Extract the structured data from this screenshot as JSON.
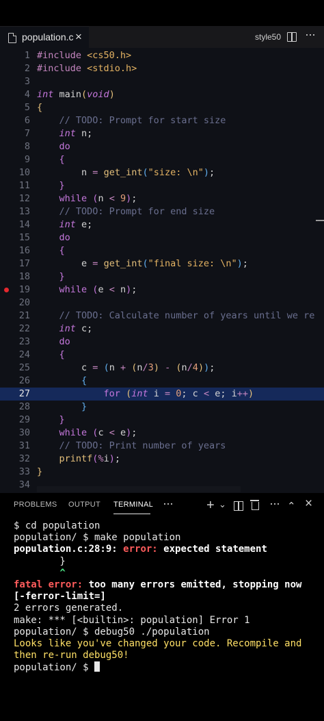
{
  "tab": {
    "filename": "population.c",
    "close": "×"
  },
  "toolbar": {
    "style50": "style50"
  },
  "editor": {
    "lines": [
      {
        "n": "1",
        "segs": [
          [
            "c-pp",
            "#include "
          ],
          [
            "c-str",
            "<cs50.h>"
          ]
        ]
      },
      {
        "n": "2",
        "segs": [
          [
            "c-pp",
            "#include "
          ],
          [
            "c-str",
            "<stdio.h>"
          ]
        ]
      },
      {
        "n": "3",
        "segs": []
      },
      {
        "n": "4",
        "segs": [
          [
            "c-type",
            "int"
          ],
          [
            "c-plain",
            " main"
          ],
          [
            "c-br",
            "("
          ],
          [
            "c-type",
            "void"
          ],
          [
            "c-br",
            ")"
          ]
        ]
      },
      {
        "n": "5",
        "segs": [
          [
            "c-br",
            "{"
          ]
        ]
      },
      {
        "n": "6",
        "segs": [
          [
            "c-cm",
            "    // TODO: Prompt for start size"
          ]
        ]
      },
      {
        "n": "7",
        "segs": [
          [
            "c-plain",
            "    "
          ],
          [
            "c-type",
            "int"
          ],
          [
            "c-plain",
            " n;"
          ]
        ]
      },
      {
        "n": "8",
        "segs": [
          [
            "c-plain",
            "    "
          ],
          [
            "c-kw",
            "do"
          ]
        ]
      },
      {
        "n": "9",
        "segs": [
          [
            "c-plain",
            "    "
          ],
          [
            "c-br2",
            "{"
          ]
        ]
      },
      {
        "n": "10",
        "segs": [
          [
            "c-plain",
            "        n "
          ],
          [
            "c-op",
            "="
          ],
          [
            "c-plain",
            " "
          ],
          [
            "c-fn",
            "get_int"
          ],
          [
            "c-br3",
            "("
          ],
          [
            "c-str",
            "\"size: \\n\""
          ],
          [
            "c-br3",
            ")"
          ],
          [
            "c-plain",
            ";"
          ]
        ]
      },
      {
        "n": "11",
        "segs": [
          [
            "c-plain",
            "    "
          ],
          [
            "c-br2",
            "}"
          ]
        ]
      },
      {
        "n": "12",
        "segs": [
          [
            "c-plain",
            "    "
          ],
          [
            "c-kw",
            "while"
          ],
          [
            "c-plain",
            " "
          ],
          [
            "c-br2",
            "("
          ],
          [
            "c-plain",
            "n "
          ],
          [
            "c-op",
            "<"
          ],
          [
            "c-plain",
            " "
          ],
          [
            "c-num",
            "9"
          ],
          [
            "c-br2",
            ")"
          ],
          [
            "c-plain",
            ";"
          ]
        ]
      },
      {
        "n": "13",
        "segs": [
          [
            "c-cm",
            "    // TODO: Prompt for end size"
          ]
        ]
      },
      {
        "n": "14",
        "segs": [
          [
            "c-plain",
            "    "
          ],
          [
            "c-type",
            "int"
          ],
          [
            "c-plain",
            " e;"
          ]
        ]
      },
      {
        "n": "15",
        "segs": [
          [
            "c-plain",
            "    "
          ],
          [
            "c-kw",
            "do"
          ]
        ]
      },
      {
        "n": "16",
        "segs": [
          [
            "c-plain",
            "    "
          ],
          [
            "c-br2",
            "{"
          ]
        ]
      },
      {
        "n": "17",
        "segs": [
          [
            "c-plain",
            "        e "
          ],
          [
            "c-op",
            "="
          ],
          [
            "c-plain",
            " "
          ],
          [
            "c-fn",
            "get_int"
          ],
          [
            "c-br3",
            "("
          ],
          [
            "c-str",
            "\"final size: \\n\""
          ],
          [
            "c-br3",
            ")"
          ],
          [
            "c-plain",
            ";"
          ]
        ]
      },
      {
        "n": "18",
        "segs": [
          [
            "c-plain",
            "    "
          ],
          [
            "c-br2",
            "}"
          ]
        ]
      },
      {
        "n": "19",
        "segs": [
          [
            "c-plain",
            "    "
          ],
          [
            "c-kw",
            "while"
          ],
          [
            "c-plain",
            " "
          ],
          [
            "c-br2",
            "("
          ],
          [
            "c-plain",
            "e "
          ],
          [
            "c-op",
            "<"
          ],
          [
            "c-plain",
            " n"
          ],
          [
            "c-br2",
            ")"
          ],
          [
            "c-plain",
            ";"
          ]
        ],
        "breakpoint": true
      },
      {
        "n": "20",
        "segs": []
      },
      {
        "n": "21",
        "segs": [
          [
            "c-cm",
            "    // TODO: Calculate number of years until we re"
          ]
        ]
      },
      {
        "n": "22",
        "segs": [
          [
            "c-plain",
            "    "
          ],
          [
            "c-type",
            "int"
          ],
          [
            "c-plain",
            " c;"
          ]
        ]
      },
      {
        "n": "23",
        "segs": [
          [
            "c-plain",
            "    "
          ],
          [
            "c-kw",
            "do"
          ]
        ]
      },
      {
        "n": "24",
        "segs": [
          [
            "c-plain",
            "    "
          ],
          [
            "c-br2",
            "{"
          ]
        ]
      },
      {
        "n": "25",
        "segs": [
          [
            "c-plain",
            "        c "
          ],
          [
            "c-op",
            "="
          ],
          [
            "c-plain",
            " "
          ],
          [
            "c-br3",
            "("
          ],
          [
            "c-plain",
            "n "
          ],
          [
            "c-op",
            "+"
          ],
          [
            "c-plain",
            " "
          ],
          [
            "c-br",
            "("
          ],
          [
            "c-plain",
            "n"
          ],
          [
            "c-op",
            "/"
          ],
          [
            "c-num",
            "3"
          ],
          [
            "c-br",
            ")"
          ],
          [
            "c-plain",
            " "
          ],
          [
            "c-op",
            "-"
          ],
          [
            "c-plain",
            " "
          ],
          [
            "c-br",
            "("
          ],
          [
            "c-plain",
            "n"
          ],
          [
            "c-op",
            "/"
          ],
          [
            "c-num",
            "4"
          ],
          [
            "c-br",
            ")"
          ],
          [
            "c-br3",
            ")"
          ],
          [
            "c-plain",
            ";"
          ]
        ]
      },
      {
        "n": "26",
        "segs": [
          [
            "c-plain",
            "        "
          ],
          [
            "c-br3",
            "{"
          ]
        ]
      },
      {
        "n": "27",
        "segs": [
          [
            "c-plain",
            "            "
          ],
          [
            "c-kw",
            "for"
          ],
          [
            "c-plain",
            " "
          ],
          [
            "c-br",
            "("
          ],
          [
            "c-type",
            "int"
          ],
          [
            "c-plain",
            " i "
          ],
          [
            "c-op",
            "="
          ],
          [
            "c-plain",
            " "
          ],
          [
            "c-num",
            "0"
          ],
          [
            "c-plain",
            "; c "
          ],
          [
            "c-op",
            "<"
          ],
          [
            "c-plain",
            " e; i"
          ],
          [
            "c-op",
            "++"
          ],
          [
            "c-br",
            ")"
          ]
        ],
        "active": true
      },
      {
        "n": "28",
        "segs": [
          [
            "c-plain",
            "        "
          ],
          [
            "c-br3",
            "}"
          ]
        ]
      },
      {
        "n": "29",
        "segs": [
          [
            "c-plain",
            "    "
          ],
          [
            "c-br2",
            "}"
          ]
        ]
      },
      {
        "n": "30",
        "segs": [
          [
            "c-plain",
            "    "
          ],
          [
            "c-kw",
            "while"
          ],
          [
            "c-plain",
            " "
          ],
          [
            "c-br2",
            "("
          ],
          [
            "c-plain",
            "c "
          ],
          [
            "c-op",
            "<"
          ],
          [
            "c-plain",
            " e"
          ],
          [
            "c-br2",
            ")"
          ],
          [
            "c-plain",
            ";"
          ]
        ]
      },
      {
        "n": "31",
        "segs": [
          [
            "c-cm",
            "    // TODO: Print number of years"
          ]
        ]
      },
      {
        "n": "32",
        "segs": [
          [
            "c-plain",
            "    "
          ],
          [
            "c-fn",
            "printf"
          ],
          [
            "c-br2",
            "("
          ],
          [
            "c-op",
            "%"
          ],
          [
            "c-plain",
            "i"
          ],
          [
            "c-br2",
            ")"
          ],
          [
            "c-plain",
            ";"
          ]
        ]
      },
      {
        "n": "33",
        "segs": [
          [
            "c-br",
            "}"
          ]
        ]
      },
      {
        "n": "34",
        "segs": []
      }
    ]
  },
  "panel": {
    "tabs": [
      "PROBLEMS",
      "OUTPUT",
      "TERMINAL"
    ],
    "more": "···",
    "add": "+",
    "chevron": "⌄",
    "up": "⌃",
    "close": "×"
  },
  "terminal": {
    "lines": [
      [
        [
          "",
          "$ cd population"
        ]
      ],
      [
        [
          "",
          "population/ $ make population"
        ]
      ],
      [
        [
          "bold",
          "population.c:28:9: "
        ],
        [
          "err",
          "error: "
        ],
        [
          "bold",
          "expected statement"
        ]
      ],
      [
        [
          "",
          "        }"
        ]
      ],
      [
        [
          "grn",
          "        ^"
        ]
      ],
      [
        [
          "err",
          "fatal error: "
        ],
        [
          "bold",
          "too many errors emitted, stopping now"
        ]
      ],
      [
        [
          "bold",
          "[-ferror-limit=]"
        ]
      ],
      [
        [
          "",
          "2 errors generated."
        ]
      ],
      [
        [
          "",
          "make: *** [<builtin>: population] Error 1"
        ]
      ],
      [
        [
          "",
          "population/ $ debug50 ./population"
        ]
      ],
      [
        [
          "ylw",
          "Looks like you've changed your code. Recompile and"
        ]
      ],
      [
        [
          "ylw",
          "then re-run debug50!"
        ]
      ],
      [
        [
          "",
          "population/ $ "
        ]
      ]
    ]
  }
}
